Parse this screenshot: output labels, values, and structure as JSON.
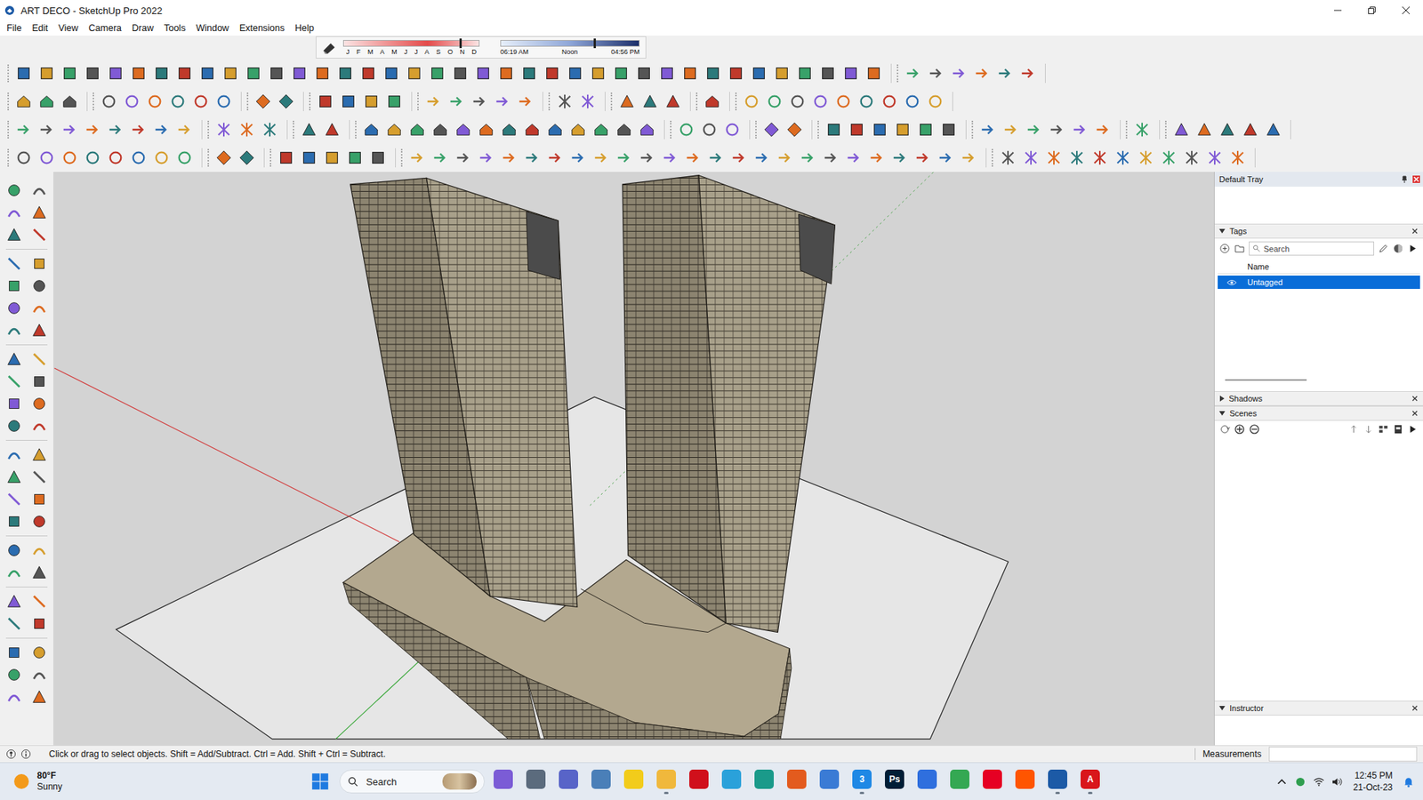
{
  "window": {
    "title": "ART DECO - SketchUp Pro 2022"
  },
  "menu": [
    "File",
    "Edit",
    "View",
    "Camera",
    "Draw",
    "Tools",
    "Window",
    "Extensions",
    "Help"
  ],
  "shadow_bar": {
    "months": [
      "J",
      "F",
      "M",
      "A",
      "M",
      "J",
      "J",
      "A",
      "S",
      "O",
      "N",
      "D"
    ],
    "date_level": 0.86,
    "times": [
      "06:19 AM",
      "Noon",
      "04:56 PM"
    ],
    "time_level": 0.68
  },
  "tray": {
    "title": "Default Tray",
    "panels": [
      {
        "title": "Tags",
        "kind": "tags",
        "expanded": true
      },
      {
        "title": "Shadows",
        "kind": "shadows",
        "expanded": false
      },
      {
        "title": "Scenes",
        "kind": "scenes",
        "expanded": true
      },
      {
        "title": "Instructor",
        "kind": "instructor",
        "expanded": true
      }
    ],
    "tags": {
      "search_placeholder": "Search",
      "column": "Name",
      "rows": [
        {
          "name": "Untagged",
          "selected": true,
          "visible": true
        }
      ]
    }
  },
  "status_bar": {
    "hint": "Click or drag to select objects. Shift = Add/Subtract. Ctrl = Add. Shift + Ctrl = Subtract.",
    "measurements_label": "Measurements"
  },
  "taskbar": {
    "weather": {
      "temp": "80°F",
      "condition": "Sunny"
    },
    "search_placeholder": "Search",
    "apps": [
      {
        "label": "",
        "color": "#7b5cd6",
        "running": false
      },
      {
        "label": "",
        "color": "#5b6b7d",
        "running": false
      },
      {
        "label": "",
        "color": "#5864c8",
        "running": false
      },
      {
        "label": "",
        "color": "#4a7fb8",
        "running": false
      },
      {
        "label": "",
        "color": "#f2cc1b",
        "running": false
      },
      {
        "label": "",
        "color": "#f0b83c",
        "running": true
      },
      {
        "label": "",
        "color": "#d0101b",
        "running": false
      },
      {
        "label": "",
        "color": "#2aa1da",
        "running": false
      },
      {
        "label": "",
        "color": "#1a9a8a",
        "running": false
      },
      {
        "label": "",
        "color": "#e35b1e",
        "running": false
      },
      {
        "label": "",
        "color": "#3a7bd5",
        "running": false
      },
      {
        "label": "3",
        "color": "#1e88e5",
        "running": true
      },
      {
        "label": "Ps",
        "color": "#001e36",
        "running": false
      },
      {
        "label": "",
        "color": "#2f6fde",
        "running": false
      },
      {
        "label": "",
        "color": "#34a853",
        "running": false
      },
      {
        "label": "",
        "color": "#e60023",
        "running": false
      },
      {
        "label": "",
        "color": "#ff5500",
        "running": false
      },
      {
        "label": "",
        "color": "#1c5aa6",
        "running": true
      },
      {
        "label": "A",
        "color": "#d9161b",
        "running": true
      }
    ],
    "clock": {
      "time": "12:45 PM",
      "date": "21-Oct-23"
    }
  }
}
